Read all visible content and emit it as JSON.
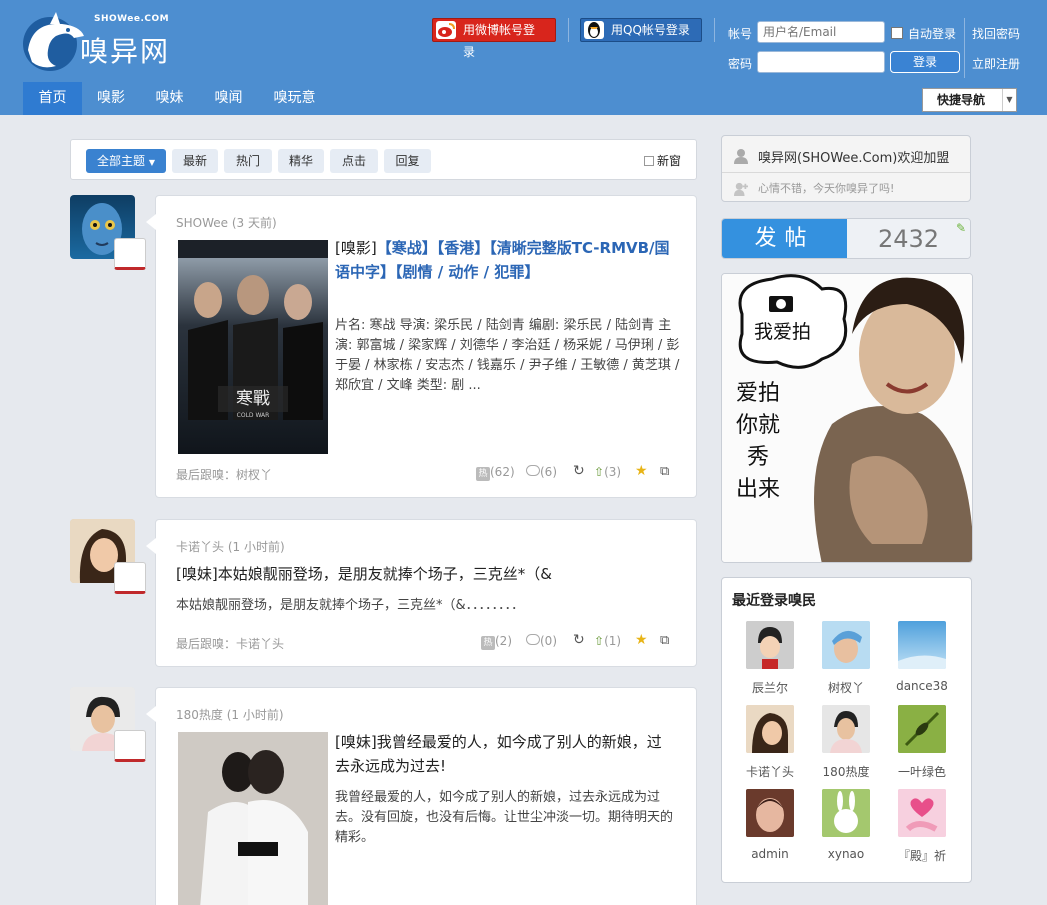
{
  "logo": {
    "sub": "SHOWee.COM",
    "name": "嗅异网"
  },
  "header": {
    "weibo_login": "用微博帐号登录",
    "qq_login": "用QQ帐号登录",
    "account_label": "帐号",
    "account_placeholder": "用户名/Email",
    "password_label": "密码",
    "auto_login": "自动登录",
    "login_button": "登录",
    "forgot_password": "找回密码",
    "register": "立即注册"
  },
  "nav": {
    "items": [
      "首页",
      "嗅影",
      "嗅妹",
      "嗅闻",
      "嗅玩意"
    ],
    "quick_nav": "快捷导航"
  },
  "filters": {
    "all_topics": "全部主题",
    "latest": "最新",
    "hot": "热门",
    "digest": "精华",
    "clicks": "点击",
    "reply": "回复",
    "new_window": "新窗"
  },
  "posts": [
    {
      "author": "SHOWee (3 天前)",
      "title_prefix": "[嗅影]",
      "title_rest": "【寒战】【香港】【清晰完整版TC-RMVB/国语中字】【剧情 / 动作 / 犯罪】",
      "body": "片名: 寒战 导演: 梁乐民 / 陆剑青 编剧: 梁乐民 / 陆剑青 主演: 郭富城 / 梁家辉 / 刘德华 / 李治廷 / 杨采妮 / 马伊琍 / 彭于晏 / 林家栋 / 安志杰 / 钱嘉乐 / 尹子维 / 王敏德 / 黄芝琪 / 郑欣宜 / 文峰 类型: 剧 ...",
      "last_reply": "最后跟嗅：树杈丫",
      "hot": "(62)",
      "comments": "(6)",
      "up": "(3)"
    },
    {
      "author": "卡诺丫头 (1 小时前)",
      "title_prefix": "[嗅妹]",
      "title_rest": "本姑娘靓丽登场，是朋友就捧个场子，三克丝*（&",
      "body": "本姑娘靓丽登场，是朋友就捧个场子，三克丝*（&．．．．．．．．",
      "last_reply": "最后跟嗅：卡诺丫头",
      "hot": "(2)",
      "comments": "(0)",
      "up": "(1)"
    },
    {
      "author": "180热度 (1 小时前)",
      "title_prefix": "[嗅妹]",
      "title_rest": "我曾经最爱的人，如今成了别人的新娘，过去永远成为过去!",
      "body": "我曾经最爱的人，如今成了别人的新娘，过去永远成为过去。没有回旋，也没有后悔。让世尘冲淡一切。期待明天的精彩。"
    }
  ],
  "poster_text": {
    "title_cn": "寒戰",
    "title_en": "COLD WAR"
  },
  "sidebar": {
    "welcome": "嗅异网(SHOWee.Com)欢迎加盟",
    "mood": "心情不错，今天你嗅异了吗!",
    "post_button": "发帖",
    "post_count": "2432",
    "ad_bubble": "我爱拍",
    "ad_lines": [
      "爱拍",
      "你就",
      "秀",
      "出来"
    ],
    "recent_title": "最近登录嗅民",
    "users": [
      "辰兰尔",
      "树杈丫",
      "dance38",
      "卡诺丫头",
      "180热度",
      "一叶绿色",
      "admin",
      "xynao",
      "『殿』祈"
    ]
  },
  "colors": {
    "header_bg": "#4d8ed0",
    "nav_active": "#2f7bd1",
    "weibo": "#d8251c",
    "qq": "#2d6bb6",
    "accent_red": "#c0292b",
    "link_blue": "#2b66b5"
  }
}
